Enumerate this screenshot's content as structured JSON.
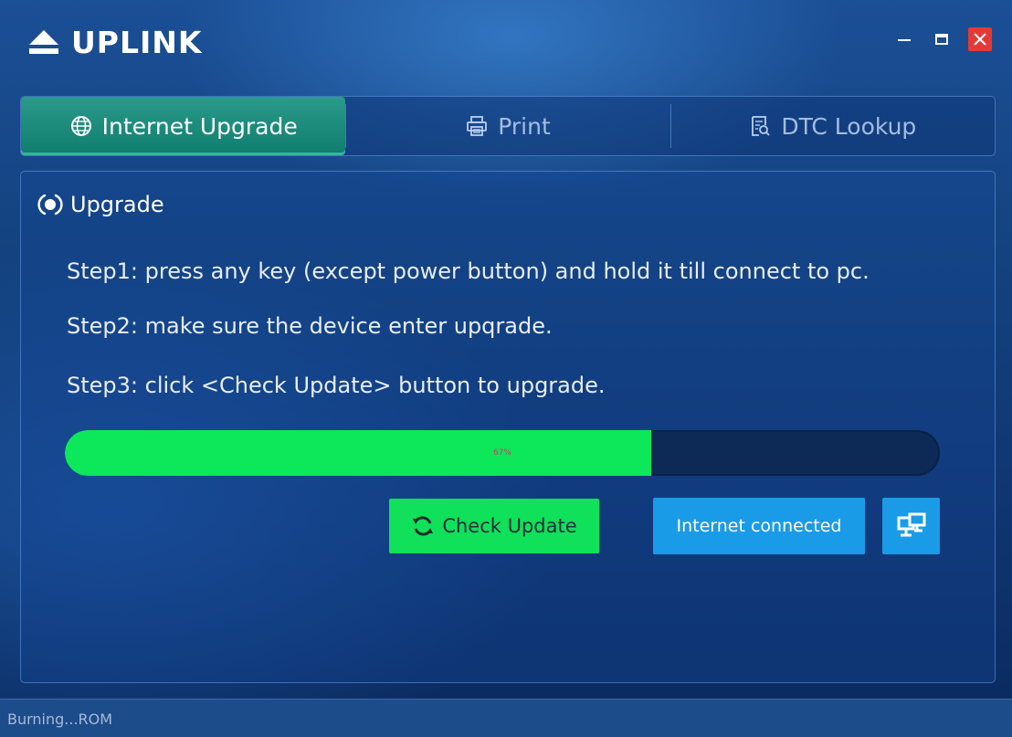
{
  "app": {
    "title": "UPLINK",
    "icons": {
      "logo": "eject-icon",
      "minimize": "minimize-icon",
      "maximize": "maximize-icon",
      "close": "close-icon"
    }
  },
  "tabs": [
    {
      "label": "Internet Upgrade",
      "icon": "globe-icon",
      "active": true
    },
    {
      "label": "Print",
      "icon": "printer-icon",
      "active": false
    },
    {
      "label": "DTC Lookup",
      "icon": "document-search-icon",
      "active": false
    }
  ],
  "upgrade": {
    "section_title": "Upgrade",
    "steps": [
      "Step1: press any key (except power button) and hold it till connect to pc.",
      "Step2: make sure the device enter upqrade.",
      "Step3: click <Check Update> button to upgrade."
    ],
    "progress": {
      "value": 0.67,
      "label": "67%"
    },
    "check_update_label": "Check Update",
    "internet_status_label": "Internet connected"
  },
  "status_bar": {
    "text": "Burning...ROM"
  },
  "colors": {
    "accent_green": "#0de85a",
    "accent_blue": "#1a9be8",
    "active_tab": "#1a8b7c",
    "close_red": "#e53935"
  }
}
